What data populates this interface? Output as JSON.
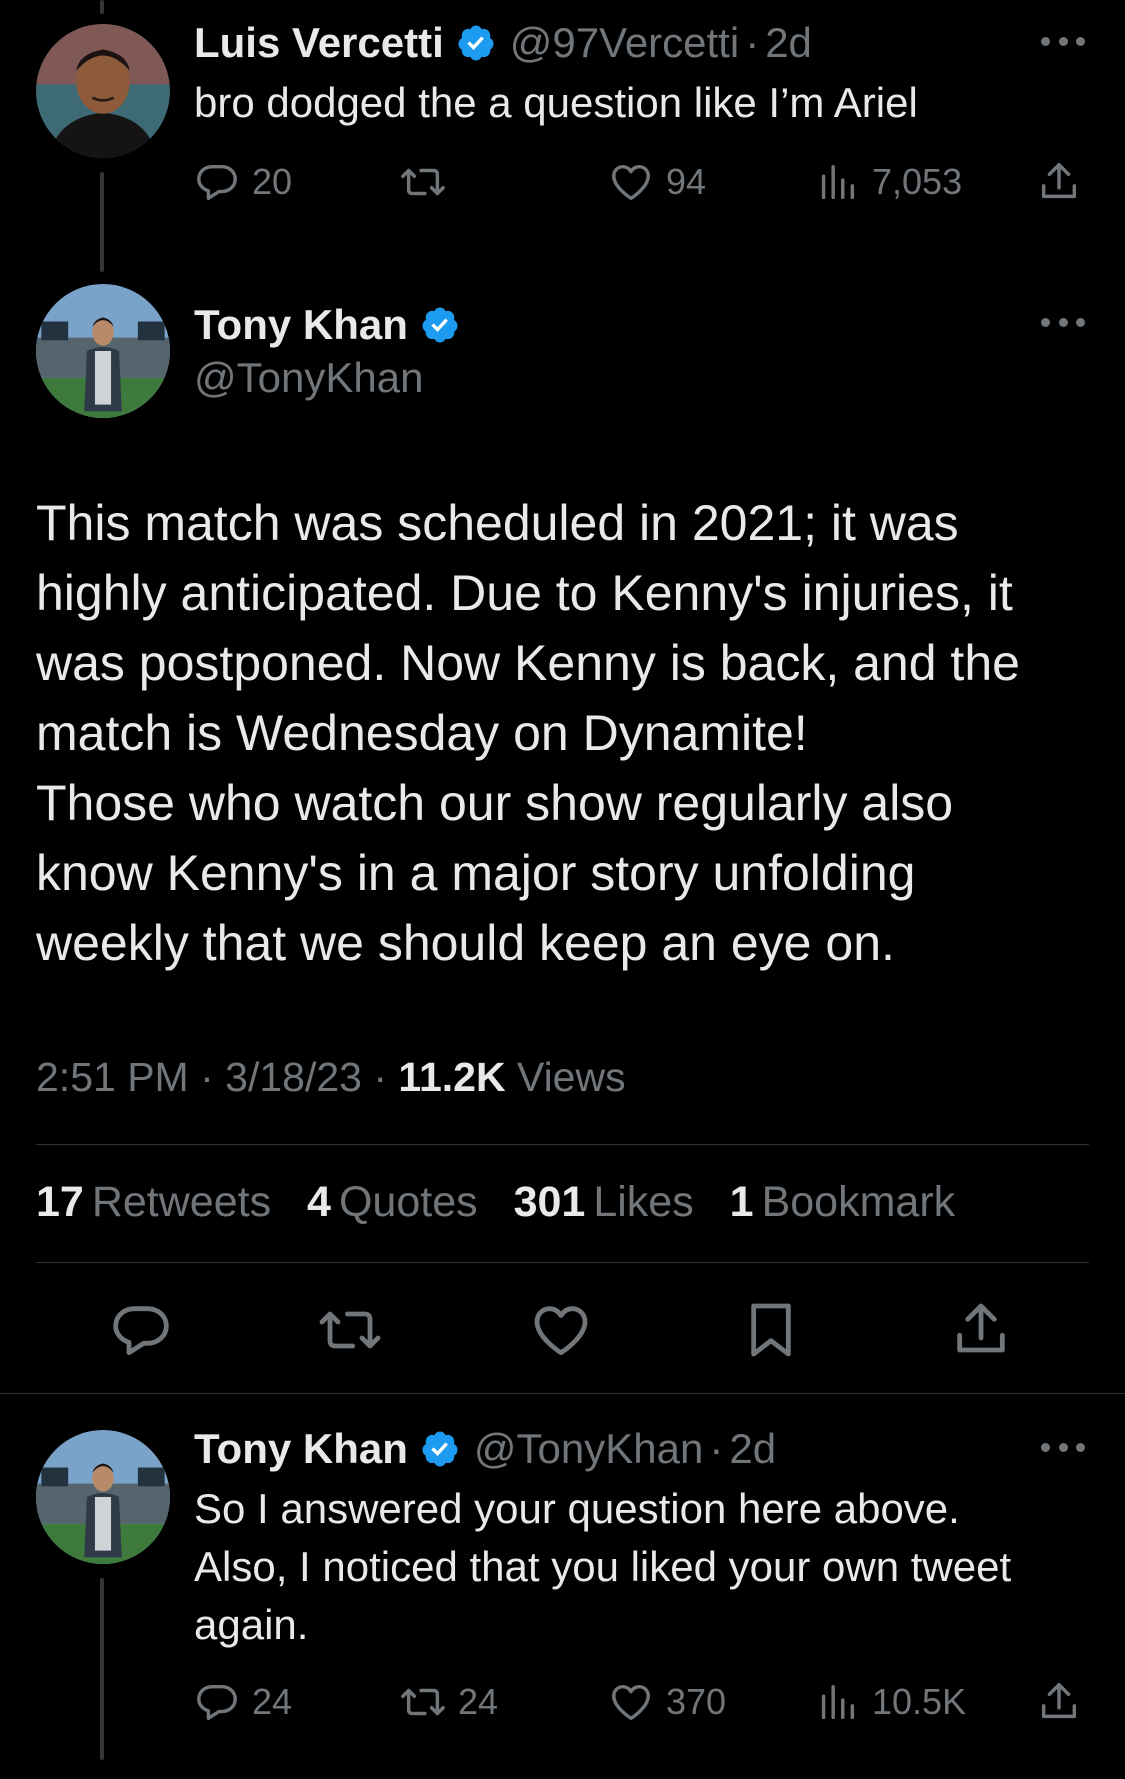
{
  "reply1": {
    "name": "Luis Vercetti",
    "handle": "@97Vercetti",
    "time": "2d",
    "text": "bro dodged the a question like I’m Ariel",
    "replies": "20",
    "retweets": "",
    "likes": "94",
    "views": "7,053"
  },
  "main": {
    "name": "Tony Khan",
    "handle": "@TonyKhan",
    "text_lines": [
      "This match was scheduled in 2021; it was",
      "highly anticipated. Due to Kenny's injuries, it",
      "was postponed. Now Kenny is back, and the",
      "match is Wednesday on Dynamite!",
      "Those who watch our show regularly also",
      "know Kenny's in a major story unfolding",
      "weekly that we should keep an eye on."
    ],
    "time": "2:51 PM",
    "date": "3/18/23",
    "views_count": "11.2K",
    "views_label": "Views",
    "stats": {
      "retweets_count": "17",
      "retweets_label": "Retweets",
      "quotes_count": "4",
      "quotes_label": "Quotes",
      "likes_count": "301",
      "likes_label": "Likes",
      "bookmarks_count": "1",
      "bookmarks_label": "Bookmark"
    }
  },
  "reply2": {
    "name": "Tony Khan",
    "handle": "@TonyKhan",
    "time": "2d",
    "text_lines": [
      "So I answered your question here above.",
      "Also, I noticed that you liked your own tweet",
      "again."
    ],
    "replies": "24",
    "retweets": "24",
    "likes": "370",
    "views": "10.5K"
  },
  "icons": {
    "verified": "verified-badge-icon",
    "reply": "reply-icon",
    "retweet": "retweet-icon",
    "like": "heart-icon",
    "views": "views-bar-chart-icon",
    "share": "share-icon",
    "bookmark": "bookmark-icon",
    "more": "more-dots-icon"
  },
  "colors": {
    "background": "#000000",
    "text": "#e7e9ea",
    "muted": "#71767b",
    "verified": "#1d9bf0",
    "divider": "#2f3336"
  }
}
